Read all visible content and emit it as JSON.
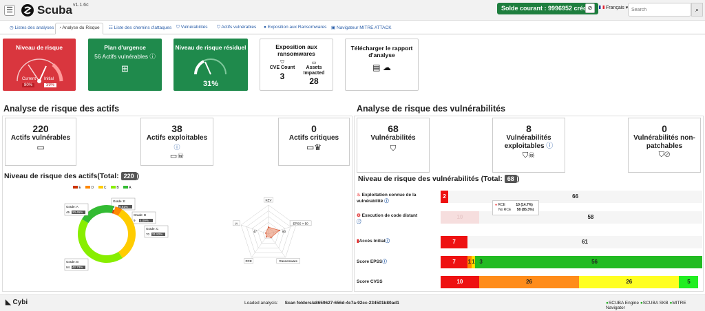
{
  "app": {
    "name": "Scuba",
    "version": "v1.1.6c",
    "credit": "Solde courant : 9996952 crédits",
    "language": "Français",
    "search_placeholder": "Search"
  },
  "tabs": [
    "Listes des analyses",
    "Analyse du Risque",
    "Liste des chemins d'attaques",
    "Vulnérabilités",
    "Actifs vulnérables",
    "Exposition aux Ransomwares",
    "Navigateur MITRE ATTACK"
  ],
  "cards": {
    "risk": {
      "title": "Niveau de risque",
      "current_label": "Current",
      "current": "80%",
      "initial_label": "Initial",
      "initial": "39%"
    },
    "plan": {
      "title": "Plan d'urgence",
      "subtitle": "56 Actifs vulnérables"
    },
    "residual": {
      "title": "Niveau de risque résiduel",
      "value": "31%",
      "level": 0.31
    },
    "ransom": {
      "title": "Exposition aux ransomwares",
      "cve_label": "CVE Count",
      "cve": "3",
      "assets_label": "Assets Impacted",
      "assets": "28"
    },
    "report": {
      "title": "Télécharger le rapport d'analyse"
    }
  },
  "assets": {
    "heading": "Analyse de risque des actifs",
    "vulnerable": {
      "n": "220",
      "label": "Actifs vulnérables"
    },
    "exploitable": {
      "n": "38",
      "label": "Actifs exploitables"
    },
    "critical": {
      "n": "0",
      "label": "Actifs critiques"
    },
    "risk_title": "Niveau de risque des actifs(Total:",
    "risk_total": "220",
    "legend": [
      "E",
      "D",
      "C",
      "B",
      "A"
    ]
  },
  "chart_data": [
    {
      "type": "pie",
      "title": "",
      "series": [
        {
          "name": "Grade: E",
          "count": "2",
          "pct": "0.91%",
          "value": 0.91,
          "color": "#cc3300"
        },
        {
          "name": "Grade: D",
          "count": "9",
          "pct": "4.09%",
          "value": 4.09,
          "color": "#ff8800"
        },
        {
          "name": "Grade: C",
          "count": "70",
          "pct": "31.82%",
          "value": 31.82,
          "color": "#ffcc00"
        },
        {
          "name": "Grade: B",
          "count": "94",
          "pct": "42.73%",
          "value": 42.73,
          "color": "#88ee00"
        },
        {
          "name": "Grade: A",
          "count": "45",
          "pct": "20.45%",
          "value": 20.45,
          "color": "#33bb33"
        }
      ]
    },
    {
      "type": "radar",
      "title": "",
      "axes": [
        "KEV",
        "EPSS > 50",
        "Ransomware",
        "RCE",
        "IA"
      ],
      "values": [
        47,
        80,
        30,
        25,
        20
      ],
      "labels": [
        "47",
        "80"
      ]
    }
  ],
  "vulns": {
    "heading": "Analyse de risque des vulnérabilités",
    "total": {
      "n": "68",
      "label": "Vulnérabilités"
    },
    "exploitable": {
      "n": "8",
      "label": "Vulnérabilités exploitables"
    },
    "unpatchable": {
      "n": "0",
      "label": "Vulnérabilités non-patchables"
    },
    "risk_title": "Niveau de risque des vulnérabilités (Total:",
    "risk_total": "68",
    "rows": [
      {
        "label": "Exploitation connue de la vulnérabilité",
        "segs": [
          {
            "v": "2",
            "w": 2,
            "c": "#ee1111"
          },
          {
            "v": "66",
            "w": 66,
            "c": "#f5f5f5"
          }
        ]
      },
      {
        "label": "Execution de code distant",
        "segs": [
          {
            "v": "10",
            "w": 10,
            "c": "#f6dede"
          },
          {
            "v": "58",
            "w": 58,
            "c": "#f5f5f5"
          }
        ]
      },
      {
        "label": "Accès Initial",
        "segs": [
          {
            "v": "7",
            "w": 7,
            "c": "#ee1111"
          },
          {
            "v": "61",
            "w": 61,
            "c": "#f5f5f5"
          }
        ]
      },
      {
        "label": "Score EPSS",
        "segs": [
          {
            "v": "7",
            "w": 7,
            "c": "#ee1111"
          },
          {
            "v": "1",
            "w": 1,
            "c": "#ff8800"
          },
          {
            "v": "1",
            "w": 1,
            "c": "#ffdd00"
          },
          {
            "v": "3",
            "w": 3,
            "c": "#22bb22"
          },
          {
            "v": "56",
            "w": 56,
            "c": "#22bb22"
          }
        ]
      },
      {
        "label": "Score CVSS",
        "segs": [
          {
            "v": "10",
            "w": 10,
            "c": "#ee1111"
          },
          {
            "v": "26",
            "w": 26,
            "c": "#ff8c1a"
          },
          {
            "v": "26",
            "w": 26,
            "c": "#ffff22"
          },
          {
            "v": "5",
            "w": 5,
            "c": "#22ee22"
          }
        ]
      }
    ],
    "tooltip": {
      "rce": "RCE",
      "rce_v": "10 (14.7%)",
      "norce": "No RCE",
      "norce_v": "58 (85.3%)"
    }
  },
  "footer": {
    "brand": "Cybi",
    "loaded_label": "Loaded analysis:",
    "loaded": "Scan folders/a8659627-656d-4c7a-92cc-234501b80ad1",
    "engine": "SCUBA Engine",
    "skb": "SCUBA SKB",
    "mitre": "MITRE Navigator"
  }
}
